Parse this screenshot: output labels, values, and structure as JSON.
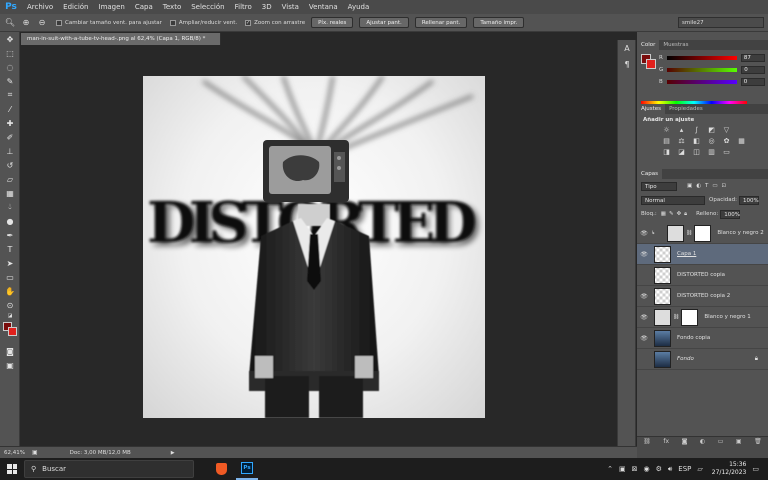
{
  "app": {
    "logo": "Ps"
  },
  "menu": [
    "Archivo",
    "Edición",
    "Imagen",
    "Capa",
    "Texto",
    "Selección",
    "Filtro",
    "3D",
    "Vista",
    "Ventana",
    "Ayuda"
  ],
  "options": {
    "resize_windows": "Cambiar tamaño vent. para ajustar",
    "zoom_all": "Ampliar/reducir vent.",
    "scrubby_zoom": "Zoom con arrastre",
    "btn_actual": "Píx. reales",
    "btn_fit": "Ajustar pant.",
    "btn_fill": "Rellenar pant.",
    "btn_print": "Tamaño impr.",
    "workspace": "smile27"
  },
  "document": {
    "tab_title": "man-in-suit-with-a-tube-tv-head-.png al 62,4% (Capa 1, RGB/8) *",
    "artwork_text": "DISTORTED"
  },
  "color_panel": {
    "tabs": [
      "Color",
      "Muestras"
    ],
    "r_label": "R",
    "r_value": "87",
    "g_label": "G",
    "g_value": "0",
    "b_label": "B",
    "b_value": "0"
  },
  "adjustments_panel": {
    "tabs": [
      "Ajustes",
      "Propiedades"
    ],
    "title": "Añadir un ajuste"
  },
  "layers_panel": {
    "tab": "Capas",
    "kind_filter": "Tipo",
    "blend_mode": "Normal",
    "opacity_label": "Opacidad:",
    "opacity_value": "100%",
    "lock_label": "Bloq.:",
    "fill_label": "Relleno:",
    "fill_value": "100%",
    "layers": [
      {
        "name": "Blanco y negro 2",
        "kind": "adjustment"
      },
      {
        "name": "Capa 1",
        "kind": "layer",
        "selected": true
      },
      {
        "name": "DISTORTED copia",
        "kind": "layer"
      },
      {
        "name": "DISTORTED copia 2",
        "kind": "layer"
      },
      {
        "name": "Blanco y negro 1",
        "kind": "adjustment"
      },
      {
        "name": "Fondo copia",
        "kind": "photo"
      },
      {
        "name": "Fondo",
        "kind": "background"
      }
    ]
  },
  "status": {
    "zoom": "62,41%",
    "doc_info": "Doc: 3,00 MB/12,0 MB"
  },
  "taskbar": {
    "search": "Buscar",
    "language": "ESP",
    "time": "15:36",
    "date": "27/12/2023"
  },
  "colors": {
    "foreground": "#7a0d0d",
    "background": "#e0201c",
    "accent": "#31a8ff"
  }
}
